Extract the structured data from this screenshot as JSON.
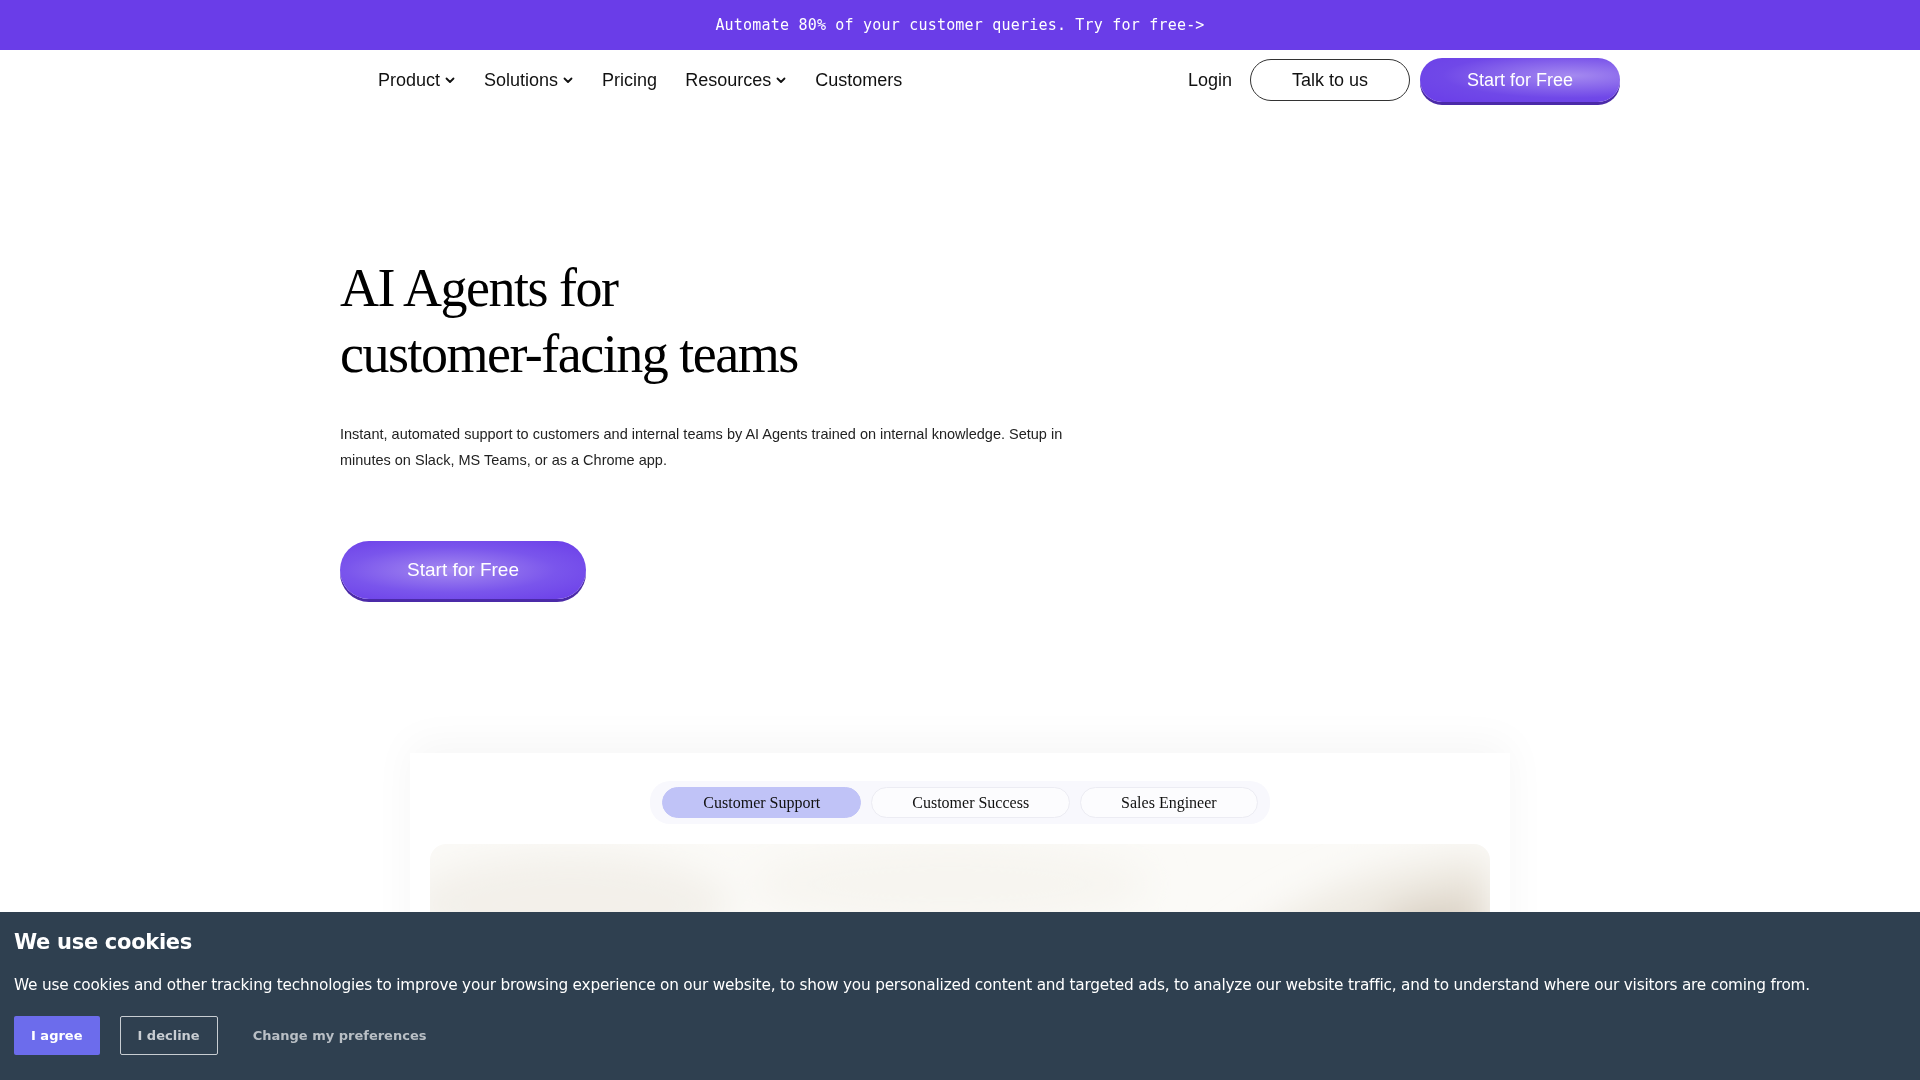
{
  "banner": {
    "text": "Automate 80% of your customer queries. Try for free->"
  },
  "nav": {
    "items": [
      {
        "label": "Product",
        "dropdown": true
      },
      {
        "label": "Solutions",
        "dropdown": true
      },
      {
        "label": "Pricing",
        "dropdown": false
      },
      {
        "label": "Resources",
        "dropdown": true
      },
      {
        "label": "Customers",
        "dropdown": false
      }
    ],
    "login": "Login",
    "talk_button": "Talk to us",
    "start_button": "Start for Free"
  },
  "hero": {
    "title_lines": [
      "AI Agents for",
      "customer-facing teams"
    ],
    "description": "Instant, automated support to customers and internal teams by AI Agents trained on internal knowledge. Setup in minutes on Slack, MS Teams, or as a Chrome app.",
    "button": "Start for Free"
  },
  "demo": {
    "tabs": [
      {
        "label": "Customer Support",
        "selected": true
      },
      {
        "label": "Customer Success",
        "selected": false
      },
      {
        "label": "Sales Engineer",
        "selected": false
      }
    ]
  },
  "cookie_banner": {
    "title": "We use cookies",
    "text": "We use cookies and other tracking technologies to improve your browsing experience on our website, to show you personalized content and targeted ads, to analyze our website traffic, and to understand where our visitors are coming from.",
    "buttons": [
      {
        "label": "I agree",
        "kind": "primary"
      },
      {
        "label": "I decline",
        "kind": "outline"
      },
      {
        "label": "Change my preferences",
        "kind": "text"
      }
    ]
  }
}
